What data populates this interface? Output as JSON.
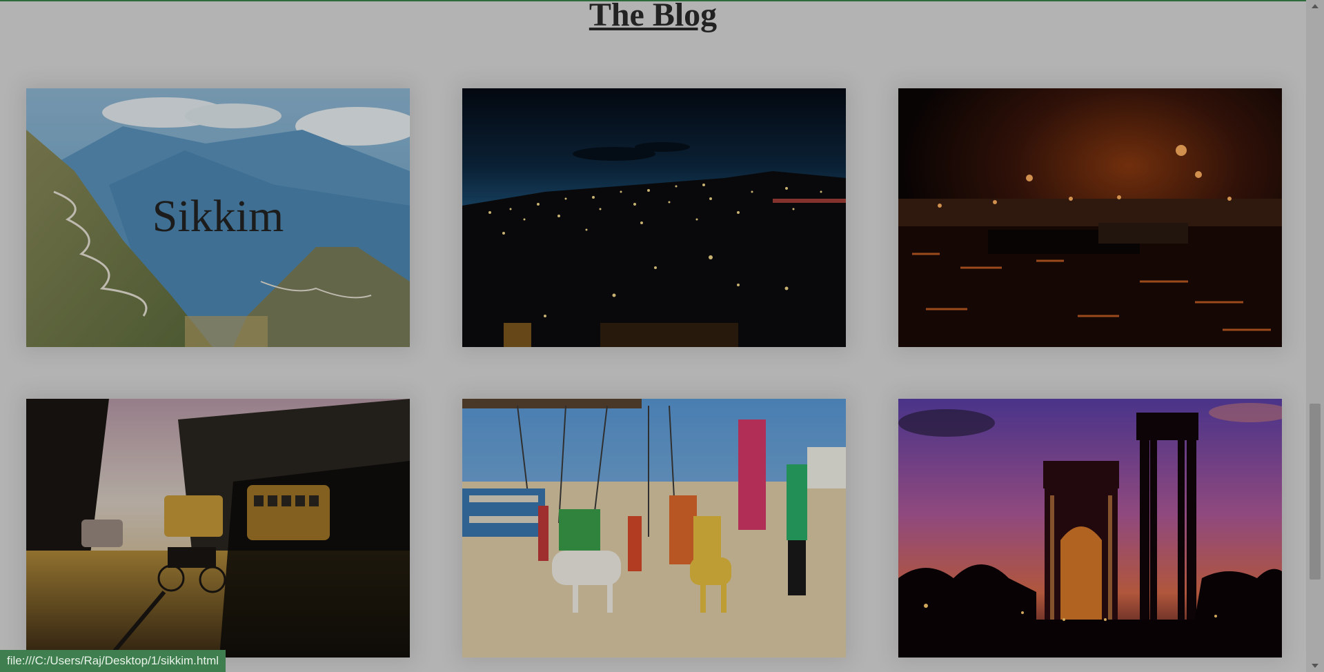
{
  "page": {
    "title": "The Blog"
  },
  "cards": [
    {
      "caption": "Sikkim",
      "image": "mountain-valley-road"
    },
    {
      "caption": "",
      "image": "city-night-lights"
    },
    {
      "caption": "",
      "image": "river-ghat-night"
    },
    {
      "caption": "",
      "image": "street-rickshaw-buses"
    },
    {
      "caption": "",
      "image": "beach-swings-horses"
    },
    {
      "caption": "",
      "image": "india-gate-sunset"
    }
  ],
  "status_bar": {
    "url": "file:///C:/Users/Raj/Desktop/1/sikkim.html"
  },
  "colors": {
    "background": "#b3b3b3",
    "status_bar": "#3f7f4f",
    "top_accent": "#2e6b3a"
  }
}
